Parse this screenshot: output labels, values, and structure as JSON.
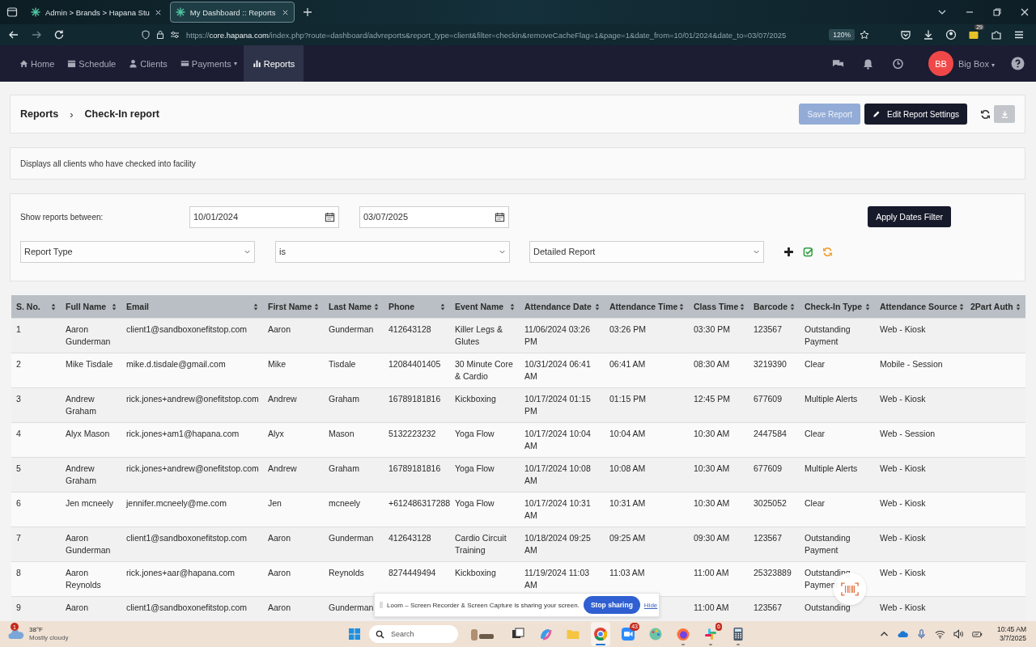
{
  "browser": {
    "tabs": [
      {
        "title": "Admin > Brands > Hapana Stu",
        "selected": false
      },
      {
        "title": "My Dashboard :: Reports",
        "selected": true
      }
    ],
    "url": {
      "scheme": "https://",
      "host": "core.hapana.com",
      "path": "/index.php?route=dashboard/advreports&report_type=client&filter=checkin&removeCacheFlag=1&page=1&date_from=10/01/2024&date_to=03/07/2025"
    },
    "zoom": "120%",
    "extension_badge": "29"
  },
  "nav": {
    "items": [
      {
        "label": "Home",
        "selected": false
      },
      {
        "label": "Schedule",
        "selected": false
      },
      {
        "label": "Clients",
        "selected": false
      },
      {
        "label": "Payments",
        "caret": "▾",
        "selected": false
      },
      {
        "label": "Reports",
        "selected": true
      }
    ],
    "avatar": "BB",
    "user": "Big Box",
    "user_caret": "▾"
  },
  "header": {
    "breadcrumb": [
      "Reports",
      "Check-In report"
    ],
    "separator": "›",
    "save_button": {
      "label": "Save Report",
      "disabled": true
    },
    "edit_button": "Edit Report Settings",
    "download_disabled": true
  },
  "description": "Displays all clients who have checked into facility",
  "filter": {
    "label": "Show reports between:",
    "date_from": "10/01/2024",
    "date_to": "03/07/2025",
    "apply_button": "Apply Dates Filter",
    "selects": [
      "Report Type",
      "is",
      "Detailed Report"
    ]
  },
  "table": {
    "columns": [
      "S. No.",
      "Full Name",
      "Email",
      "First Name",
      "Last Name",
      "Phone",
      "Event Name",
      "Attendance Date",
      "Attendance Time",
      "Class Time",
      "Barcode",
      "Check-In Type",
      "Attendance Source",
      "2Part Auth"
    ],
    "rows": [
      [
        "1",
        "Aaron Gunderman",
        "client1@sandboxonefitstop.com",
        "Aaron",
        "Gunderman",
        "412643128",
        "Killer Legs & Glutes",
        "11/06/2024 03:26 PM",
        "03:26 PM",
        "03:30 PM",
        "123567",
        "Outstanding Payment",
        "Web - Kiosk"
      ],
      [
        "2",
        "Mike Tisdale",
        "mike.d.tisdale@gmail.com",
        "Mike",
        "Tisdale",
        "12084401405",
        "30 Minute Core & Cardio",
        "10/31/2024 06:41 AM",
        "06:41 AM",
        "08:30 AM",
        "3219390",
        "Clear",
        "Mobile - Session"
      ],
      [
        "3",
        "Andrew Graham",
        "rick.jones+andrew@onefitstop.com",
        "Andrew",
        "Graham",
        "16789181816",
        "Kickboxing",
        "10/17/2024 01:15 PM",
        "01:15 PM",
        "12:45 PM",
        "677609",
        "Multiple Alerts",
        "Web - Kiosk"
      ],
      [
        "4",
        "Alyx Mason",
        "rick.jones+am1@hapana.com",
        "Alyx",
        "Mason",
        "5132223232",
        "Yoga Flow",
        "10/17/2024 10:04 AM",
        "10:04 AM",
        "10:30 AM",
        "2447584",
        "Clear",
        "Web - Session"
      ],
      [
        "5",
        "Andrew Graham",
        "rick.jones+andrew@onefitstop.com",
        "Andrew",
        "Graham",
        "16789181816",
        "Yoga Flow",
        "10/17/2024 10:08 AM",
        "10:08 AM",
        "10:30 AM",
        "677609",
        "Multiple Alerts",
        "Web - Kiosk"
      ],
      [
        "6",
        "Jen mcneely",
        "jennifer.mcneely@me.com",
        "Jen",
        "mcneely",
        "+612486317288",
        "Yoga Flow",
        "10/17/2024 10:31 AM",
        "10:31 AM",
        "10:30 AM",
        "3025052",
        "Clear",
        "Web - Kiosk"
      ],
      [
        "7",
        "Aaron Gunderman",
        "client1@sandboxonefitstop.com",
        "Aaron",
        "Gunderman",
        "412643128",
        "Cardio Circuit Training",
        "10/18/2024 09:25 AM",
        "09:25 AM",
        "09:30 AM",
        "123567",
        "Outstanding Payment",
        "Web - Kiosk"
      ],
      [
        "8",
        "Aaron Reynolds",
        "rick.jones+aar@hapana.com",
        "Aaron",
        "Reynolds",
        "8274449494",
        "Kickboxing",
        "11/19/2024 11:03 AM",
        "11:03 AM",
        "11:00 AM",
        "25323889",
        "Outstanding Payment",
        "Web - Kiosk"
      ],
      [
        "9",
        "Aaron",
        "client1@sandboxonefitstop.com",
        "Aaron",
        "Gunderman",
        null,
        null,
        null,
        null,
        "11:00 AM",
        "123567",
        "Outstanding",
        "Web - Kiosk"
      ]
    ]
  },
  "loom": {
    "message": "Loom – Screen Recorder & Screen Capture is sharing your screen.",
    "stop": "Stop sharing",
    "hide": "Hide"
  },
  "taskbar": {
    "weather": {
      "temp": "38°F",
      "condition": "Mostly cloudy",
      "badge": "1"
    },
    "search": "Search",
    "apps": [
      {
        "kind": "people",
        "running": false,
        "active": false
      },
      {
        "kind": "taskview",
        "running": false,
        "active": false
      },
      {
        "kind": "copilot",
        "running": false,
        "active": false
      },
      {
        "kind": "folder",
        "running": false,
        "active": false
      },
      {
        "kind": "chrome",
        "running": true,
        "active": true
      },
      {
        "kind": "zoom",
        "badge": "43",
        "running": false,
        "active": false
      },
      {
        "kind": "paint",
        "running": false,
        "active": false
      },
      {
        "kind": "firefox",
        "running": true,
        "active": false
      },
      {
        "kind": "slack",
        "badge": "6",
        "running": true,
        "active": false
      },
      {
        "kind": "calculator",
        "running": true,
        "active": false
      }
    ],
    "time": "10:45 AM",
    "date": "3/7/2025"
  }
}
